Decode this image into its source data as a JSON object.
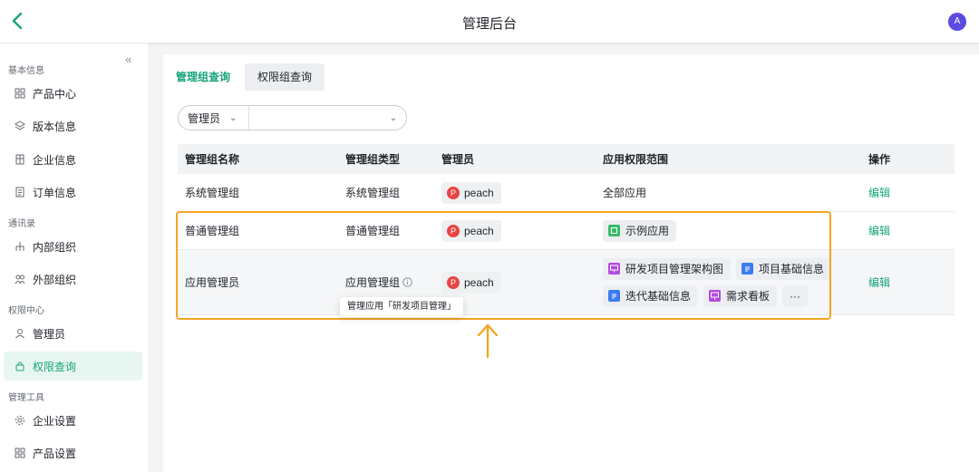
{
  "header": {
    "title": "管理后台",
    "avatar_letter": "A"
  },
  "sidebar": {
    "collapse_glyph": "«",
    "sections": [
      {
        "title": "基本信息",
        "items": [
          {
            "label": "产品中心",
            "icon": "grid-icon"
          },
          {
            "label": "版本信息",
            "icon": "layers-icon"
          },
          {
            "label": "企业信息",
            "icon": "building-icon"
          },
          {
            "label": "订单信息",
            "icon": "document-icon"
          }
        ]
      },
      {
        "title": "通讯录",
        "items": [
          {
            "label": "内部组织",
            "icon": "org-chart-icon"
          },
          {
            "label": "外部组织",
            "icon": "users-icon"
          }
        ]
      },
      {
        "title": "权限中心",
        "items": [
          {
            "label": "管理员",
            "icon": "user-icon"
          },
          {
            "label": "权限查询",
            "icon": "lock-icon",
            "active": true
          }
        ]
      },
      {
        "title": "管理工具",
        "items": [
          {
            "label": "企业设置",
            "icon": "gear-icon"
          },
          {
            "label": "产品设置",
            "icon": "grid-icon"
          }
        ]
      }
    ]
  },
  "tabs": [
    {
      "label": "管理组查询",
      "active": true
    },
    {
      "label": "权限组查询",
      "active": false
    }
  ],
  "filter": {
    "field": "管理员",
    "value": ""
  },
  "table": {
    "columns": [
      "管理组名称",
      "管理组类型",
      "管理员",
      "应用权限范围",
      "操作"
    ],
    "rows": [
      {
        "name": "系统管理组",
        "type": "系统管理组",
        "admin": "peach",
        "admin_initial": "P",
        "scope_text": "全部应用",
        "apps": [],
        "action": "编辑"
      },
      {
        "name": "普通管理组",
        "type": "普通管理组",
        "admin": "peach",
        "admin_initial": "P",
        "scope_text": "",
        "apps": [
          {
            "label": "示例应用",
            "color": "#3cbb6a"
          }
        ],
        "action": "编辑"
      },
      {
        "name": "应用管理员",
        "type": "应用管理组",
        "type_info_icon": "info-icon",
        "admin": "peach",
        "admin_initial": "P",
        "scope_text": "",
        "apps": [
          {
            "label": "研发项目管理架构图",
            "color": "#b04be0"
          },
          {
            "label": "项目基础信息",
            "color": "#3b7cf0"
          },
          {
            "label": "迭代基础信息",
            "color": "#3b7cf0"
          },
          {
            "label": "需求看板",
            "color": "#b04be0"
          }
        ],
        "more": "···",
        "action": "编辑"
      }
    ]
  },
  "tooltip": {
    "text": "管理应用「研发项目管理」"
  },
  "colors": {
    "accent": "#17a47a",
    "highlight": "#f5a524",
    "avatar_bg": "#5b4be0"
  }
}
